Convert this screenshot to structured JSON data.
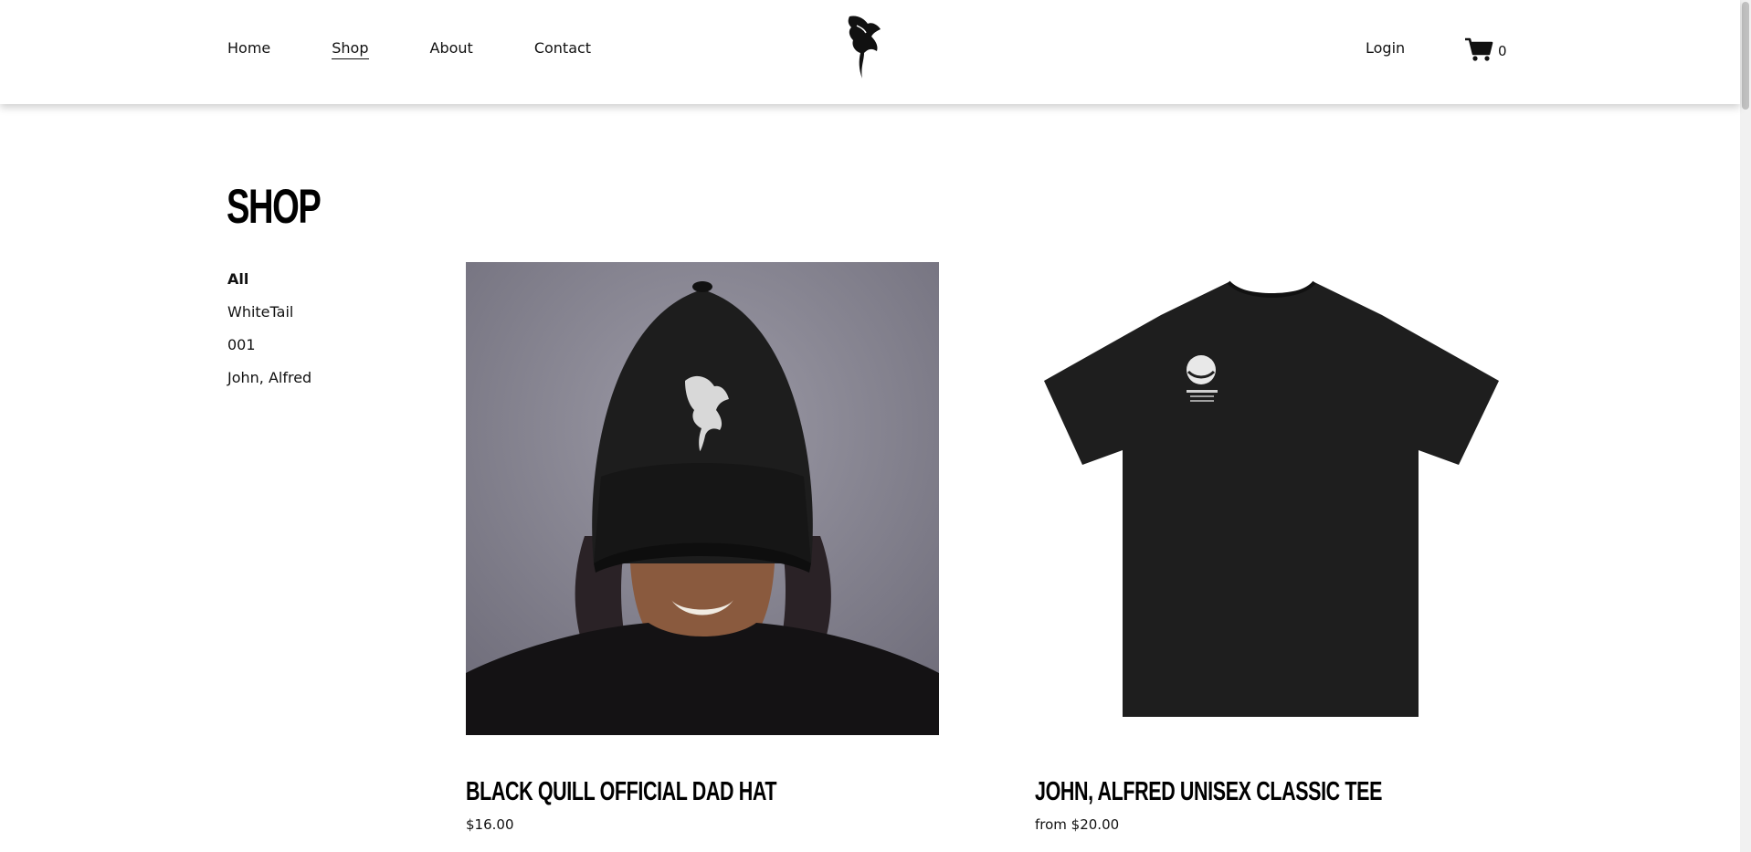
{
  "nav": {
    "items": [
      {
        "label": "Home"
      },
      {
        "label": "Shop",
        "active": true
      },
      {
        "label": "About"
      },
      {
        "label": "Contact"
      }
    ],
    "login_label": "Login",
    "cart_count": "0"
  },
  "page": {
    "title": "SHOP"
  },
  "categories": [
    {
      "label": "All",
      "active": true
    },
    {
      "label": "WhiteTail"
    },
    {
      "label": "001"
    },
    {
      "label": "John, Alfred"
    }
  ],
  "products": [
    {
      "name": "BLACK QUILL OFFICIAL DAD HAT",
      "price": "$16.00"
    },
    {
      "name": "JOHN, ALFRED UNISEX CLASSIC TEE",
      "price": "from $20.00"
    }
  ],
  "colors": {
    "text": "#111111",
    "background": "#ffffff",
    "shirt": "#1e1e1e",
    "photo_bg": "#8a8895"
  },
  "icons": [
    "quill-logo-icon",
    "cart-icon"
  ]
}
